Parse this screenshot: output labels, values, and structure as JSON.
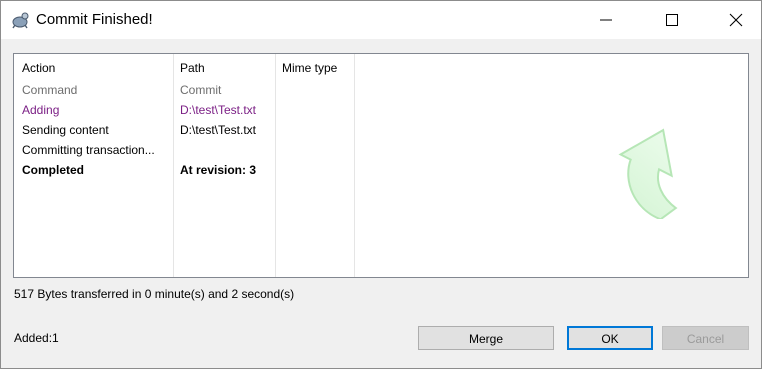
{
  "window": {
    "title": "Commit Finished!"
  },
  "list": {
    "columns": [
      "Action",
      "Path",
      "Mime type"
    ],
    "rows": [
      {
        "action": "Command",
        "path": "Commit"
      },
      {
        "action": "Adding",
        "path": "D:\\test\\Test.txt"
      },
      {
        "action": "Sending content",
        "path": "D:\\test\\Test.txt"
      },
      {
        "action": "Committing transaction...",
        "path": ""
      },
      {
        "action": "Completed",
        "path": "At revision: 3"
      }
    ]
  },
  "status": {
    "transfer": "517 Bytes transferred in 0 minute(s) and 2 second(s)",
    "added": "Added:1"
  },
  "buttons": {
    "merge": "Merge",
    "ok": "OK",
    "cancel": "Cancel"
  },
  "icons": {
    "app": "tortoise-icon",
    "minimize": "minimize-icon",
    "maximize": "maximize-icon",
    "close": "close-icon",
    "success": "green-curved-arrow-icon"
  },
  "colors": {
    "adding_row": "#7b1f85",
    "command_row": "#6d6d6d",
    "ok_border": "#0078d7"
  }
}
